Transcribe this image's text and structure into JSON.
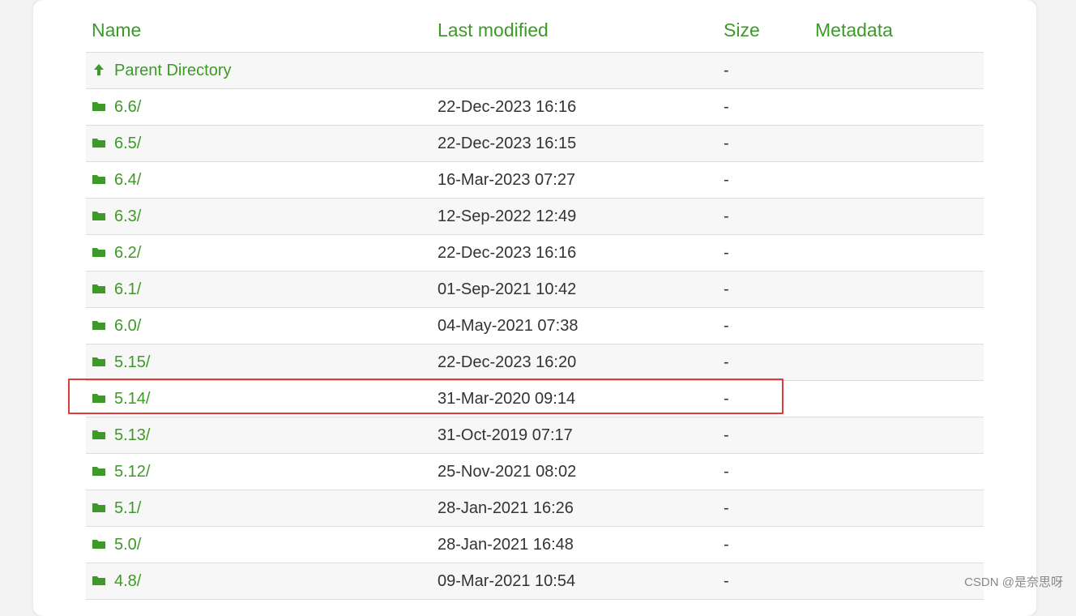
{
  "colors": {
    "link": "#3e9a28",
    "text": "#333333",
    "highlight": "#e03a3a"
  },
  "headers": {
    "name": "Name",
    "last_modified": "Last modified",
    "size": "Size",
    "metadata": "Metadata"
  },
  "rows": [
    {
      "name": "Parent Directory",
      "date": "",
      "size": "-",
      "icon": "arrow-up-icon"
    },
    {
      "name": "6.6/",
      "date": "22-Dec-2023 16:16",
      "size": "-",
      "icon": "folder-icon"
    },
    {
      "name": "6.5/",
      "date": "22-Dec-2023 16:15",
      "size": "-",
      "icon": "folder-icon"
    },
    {
      "name": "6.4/",
      "date": "16-Mar-2023 07:27",
      "size": "-",
      "icon": "folder-icon"
    },
    {
      "name": "6.3/",
      "date": "12-Sep-2022 12:49",
      "size": "-",
      "icon": "folder-icon"
    },
    {
      "name": "6.2/",
      "date": "22-Dec-2023 16:16",
      "size": "-",
      "icon": "folder-icon"
    },
    {
      "name": "6.1/",
      "date": "01-Sep-2021 10:42",
      "size": "-",
      "icon": "folder-icon"
    },
    {
      "name": "6.0/",
      "date": "04-May-2021 07:38",
      "size": "-",
      "icon": "folder-icon"
    },
    {
      "name": "5.15/",
      "date": "22-Dec-2023 16:20",
      "size": "-",
      "icon": "folder-icon"
    },
    {
      "name": "5.14/",
      "date": "31-Mar-2020 09:14",
      "size": "-",
      "icon": "folder-icon"
    },
    {
      "name": "5.13/",
      "date": "31-Oct-2019 07:17",
      "size": "-",
      "icon": "folder-icon"
    },
    {
      "name": "5.12/",
      "date": "25-Nov-2021 08:02",
      "size": "-",
      "icon": "folder-icon"
    },
    {
      "name": "5.1/",
      "date": "28-Jan-2021 16:26",
      "size": "-",
      "icon": "folder-icon"
    },
    {
      "name": "5.0/",
      "date": "28-Jan-2021 16:48",
      "size": "-",
      "icon": "folder-icon"
    },
    {
      "name": "4.8/",
      "date": "09-Mar-2021 10:54",
      "size": "-",
      "icon": "folder-icon"
    }
  ],
  "highlighted_row": "5.14/",
  "watermark": "CSDN @是奈思呀"
}
